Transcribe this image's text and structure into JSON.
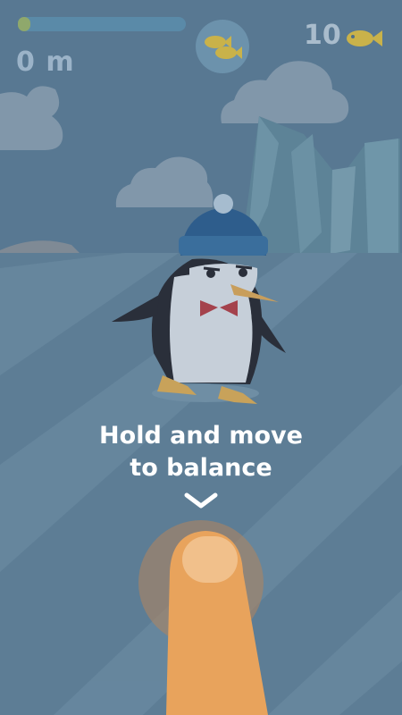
{
  "hud": {
    "distance": "0 m",
    "fish_count": "10",
    "progress_fraction": 0.07
  },
  "tutorial": {
    "line1": "Hold and move",
    "line2": "to balance"
  },
  "icons": {
    "fish_bubble": "fish-bubble-icon",
    "fish_counter": "fish-icon",
    "arrow": "chevron-down-icon",
    "finger": "finger-icon"
  },
  "colors": {
    "overlay": "#4f6f89",
    "progress_fill": "#8fa86c",
    "fish": "#c9b24a",
    "instruction_text": "#ffffff",
    "finger": "#e8a35c"
  }
}
